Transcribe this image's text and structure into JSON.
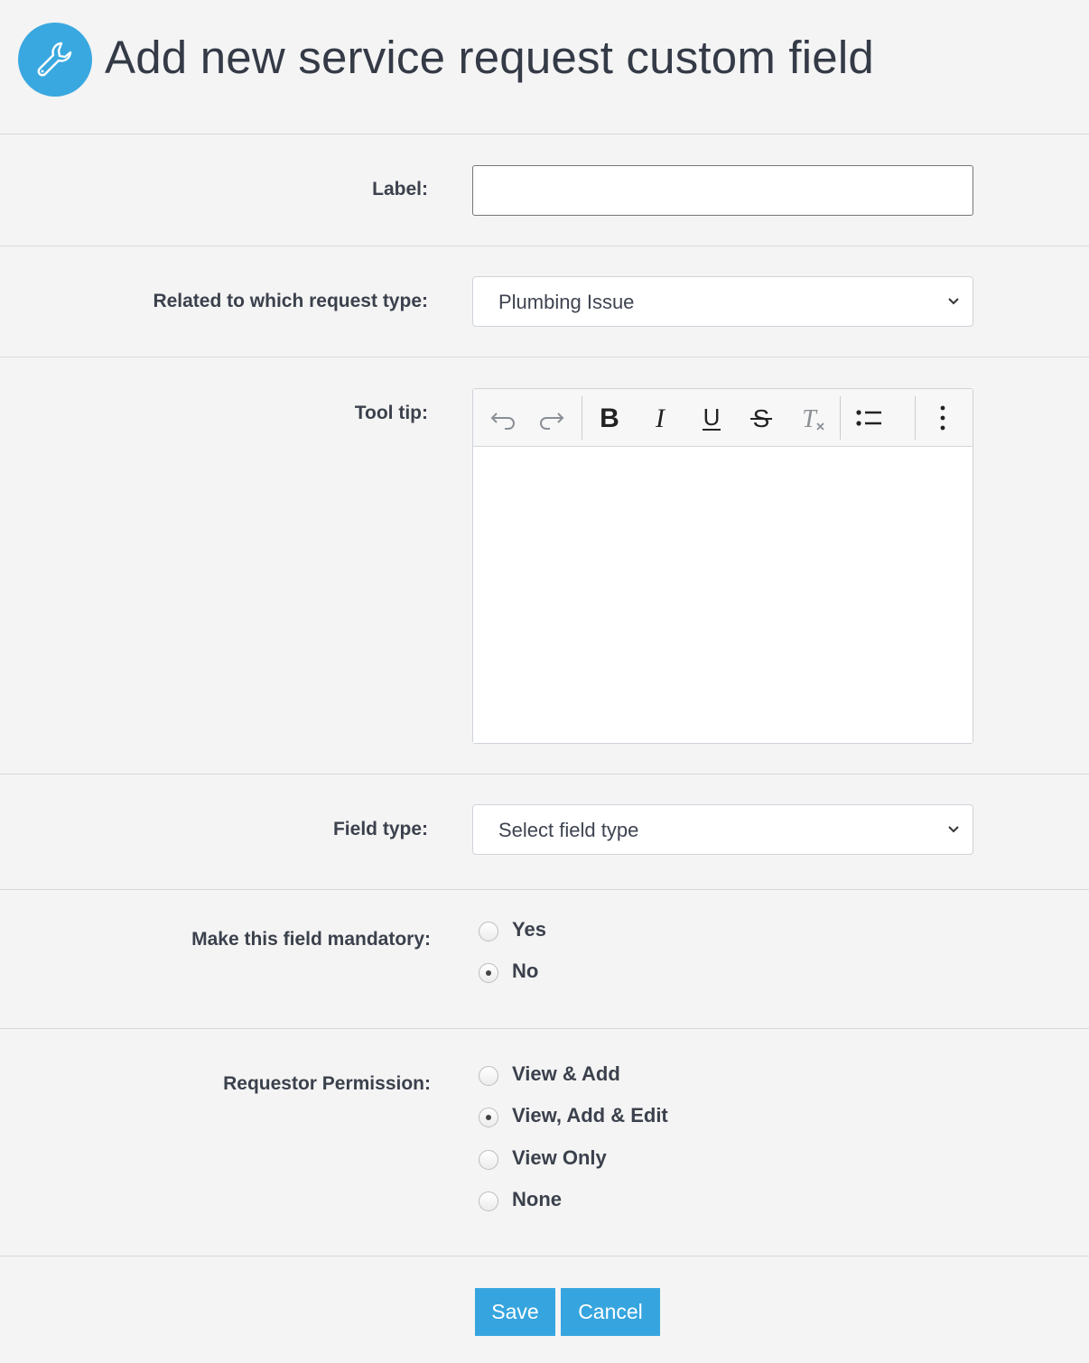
{
  "header": {
    "title": "Add new service request custom field",
    "icon": "wrench-icon",
    "icon_color": "#3aa8e0"
  },
  "form": {
    "label": {
      "label": "Label:",
      "value": ""
    },
    "request_type": {
      "label": "Related to which request type:",
      "selected": "Plumbing Issue"
    },
    "tooltip": {
      "label": "Tool tip:",
      "toolbar": [
        "undo-icon",
        "redo-icon",
        "bold-icon",
        "italic-icon",
        "underline-icon",
        "strikethrough-icon",
        "clear-formatting-icon",
        "bulleted-list-icon",
        "more-options-icon"
      ],
      "content": ""
    },
    "field_type": {
      "label": "Field type:",
      "selected": "Select field type"
    },
    "mandatory": {
      "label": "Make this field mandatory:",
      "options": [
        "Yes",
        "No"
      ],
      "selected": "No"
    },
    "permission": {
      "label": "Requestor Permission:",
      "options": [
        "View & Add",
        "View, Add & Edit",
        "View Only",
        "None"
      ],
      "selected": "View, Add & Edit"
    }
  },
  "actions": {
    "save_label": "Save",
    "cancel_label": "Cancel",
    "button_color": "#36a5df"
  }
}
